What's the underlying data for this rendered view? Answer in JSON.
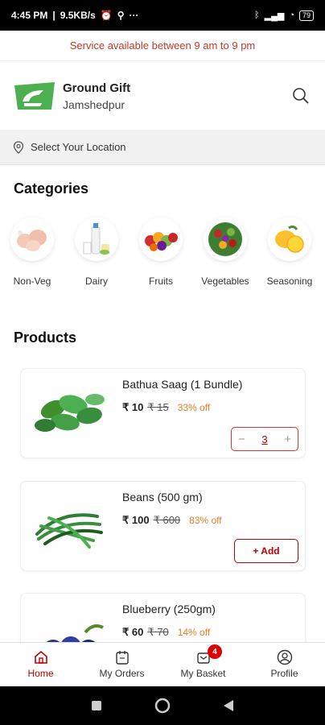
{
  "status_bar": {
    "time": "4:45 PM",
    "speed": "9.5KB/s",
    "more": "···",
    "battery": "79"
  },
  "service_banner": "Service available between 9 am to 9 pm",
  "header": {
    "brand": "Ground Gift",
    "city": "Jamshedpur"
  },
  "location": {
    "placeholder": "Select Your Location"
  },
  "categories": {
    "title": "Categories",
    "items": [
      {
        "label": "Non-Veg",
        "icon": "chicken-icon"
      },
      {
        "label": "Dairy",
        "icon": "milk-icon"
      },
      {
        "label": "Fruits",
        "icon": "fruits-icon"
      },
      {
        "label": "Vegetables",
        "icon": "vegetables-icon"
      },
      {
        "label": "Seasoning",
        "icon": "lemon-icon"
      }
    ]
  },
  "products": {
    "title": "Products",
    "items": [
      {
        "name": "Bathua Saag (1 Bundle)",
        "price": "₹ 10",
        "mrp": "₹ 15",
        "off": "33% off",
        "qty": "3",
        "minus": "−",
        "plus": "+"
      },
      {
        "name": "Beans (500 gm)",
        "price": "₹ 100",
        "mrp": "₹ 600",
        "off": "83% off",
        "add_label": "+ Add"
      },
      {
        "name": "Blueberry (250gm)",
        "price": "₹ 60",
        "mrp": "₹ 70",
        "off": "14% off"
      }
    ]
  },
  "bottom_nav": {
    "home": "Home",
    "orders": "My Orders",
    "basket": "My Basket",
    "basket_count": "4",
    "profile": "Profile"
  },
  "colors": {
    "accent": "#b00000",
    "brand_green": "#5cb85c",
    "discount": "#e67e22"
  }
}
